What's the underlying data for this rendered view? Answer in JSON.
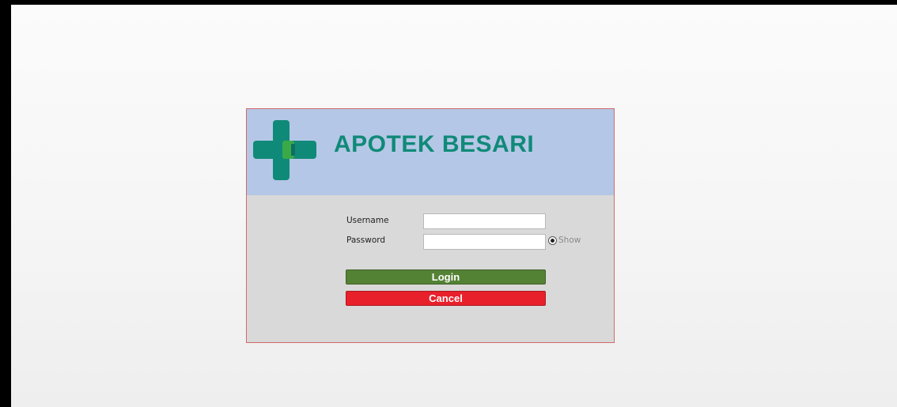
{
  "app": {
    "title": "APOTEK BESARI"
  },
  "form": {
    "username_label": "Username",
    "username_value": "",
    "password_label": "Password",
    "password_value": "",
    "show_label": "Show",
    "show_selected": true
  },
  "buttons": {
    "login_label": "Login",
    "cancel_label": "Cancel"
  },
  "colors": {
    "header_bg": "#b5c7e6",
    "title": "#108a78",
    "logo_cross": "#108a78",
    "logo_accent": "#3aaa48",
    "login_button": "#548235",
    "cancel_button": "#e8202b",
    "window_border": "#d06a6a",
    "form_bg": "#d9d9d9"
  },
  "icons": {
    "logo": "medical-cross-icon",
    "show_toggle": "radio-button-icon"
  }
}
